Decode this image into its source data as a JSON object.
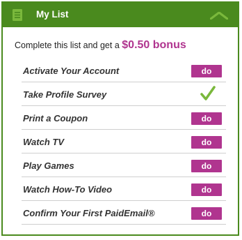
{
  "header": {
    "title": "My List",
    "icon": "list-icon",
    "collapse_icon": "chevron-up-icon",
    "background_color": "#4a8a1e"
  },
  "intro": {
    "text": "Complete this list and get a",
    "bonus": "$0.50 bonus",
    "bonus_color": "#b0358f"
  },
  "tasks": [
    {
      "label": "Activate Your Account",
      "status": "do",
      "action_label": "do"
    },
    {
      "label": "Take Profile Survey",
      "status": "completed",
      "action_label": ""
    },
    {
      "label": "Print a Coupon",
      "status": "do",
      "action_label": "do"
    },
    {
      "label": "Watch TV",
      "status": "do",
      "action_label": "do"
    },
    {
      "label": "Play Games",
      "status": "do",
      "action_label": "do"
    },
    {
      "label": "Watch How-To Video",
      "status": "do",
      "action_label": "do"
    },
    {
      "label": "Confirm Your First PaidEmail®",
      "status": "do",
      "action_label": "do"
    }
  ],
  "colors": {
    "accent": "#b0358f",
    "brand_green": "#4a8a1e",
    "check_green": "#7ab83c"
  }
}
